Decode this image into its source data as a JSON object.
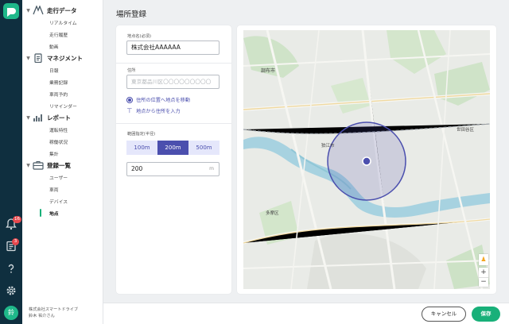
{
  "rail": {
    "notifications_badge": "16",
    "tasks_badge": "3",
    "avatar_initial": "鈴"
  },
  "nav": {
    "sections": [
      {
        "label": "走行データ",
        "items": [
          "リアルタイム",
          "走行履歴",
          "動画"
        ]
      },
      {
        "label": "マネジメント",
        "items": [
          "日報",
          "業務記録",
          "車両予約",
          "リマインダー"
        ]
      },
      {
        "label": "レポート",
        "items": [
          "運転特性",
          "稼働状況",
          "集計"
        ]
      },
      {
        "label": "登録一覧",
        "items": [
          "ユーザー",
          "車両",
          "デバイス",
          "地点"
        ]
      }
    ],
    "company": "株式会社スマートドライブ",
    "user": "鈴木 祐介さん"
  },
  "page": {
    "title": "場所登録"
  },
  "form": {
    "name_label": "地点名(必須)",
    "name_value": "株式会社AAAAAA",
    "address_label": "住所",
    "address_placeholder": "東京都品川区〇〇〇〇〇〇〇〇〇",
    "option_move_pin": "住所の位置へ地点を移動",
    "option_fill_address": "地点から住所を入力",
    "range_label": "範囲指定(半径)",
    "range_options": [
      "100m",
      "200m",
      "500m"
    ],
    "range_selected": "200m",
    "radius_value": "200",
    "radius_unit": "m"
  },
  "map": {
    "labels": [
      "調布市",
      "狛江市",
      "多摩区",
      "世田谷区"
    ],
    "zoom_in": "+",
    "zoom_out": "−"
  },
  "footer": {
    "cancel_label": "キャンセル",
    "save_label": "保存"
  },
  "colors": {
    "accent": "#4b4fae",
    "primary": "#18b079",
    "rail": "#0f2f3f"
  }
}
